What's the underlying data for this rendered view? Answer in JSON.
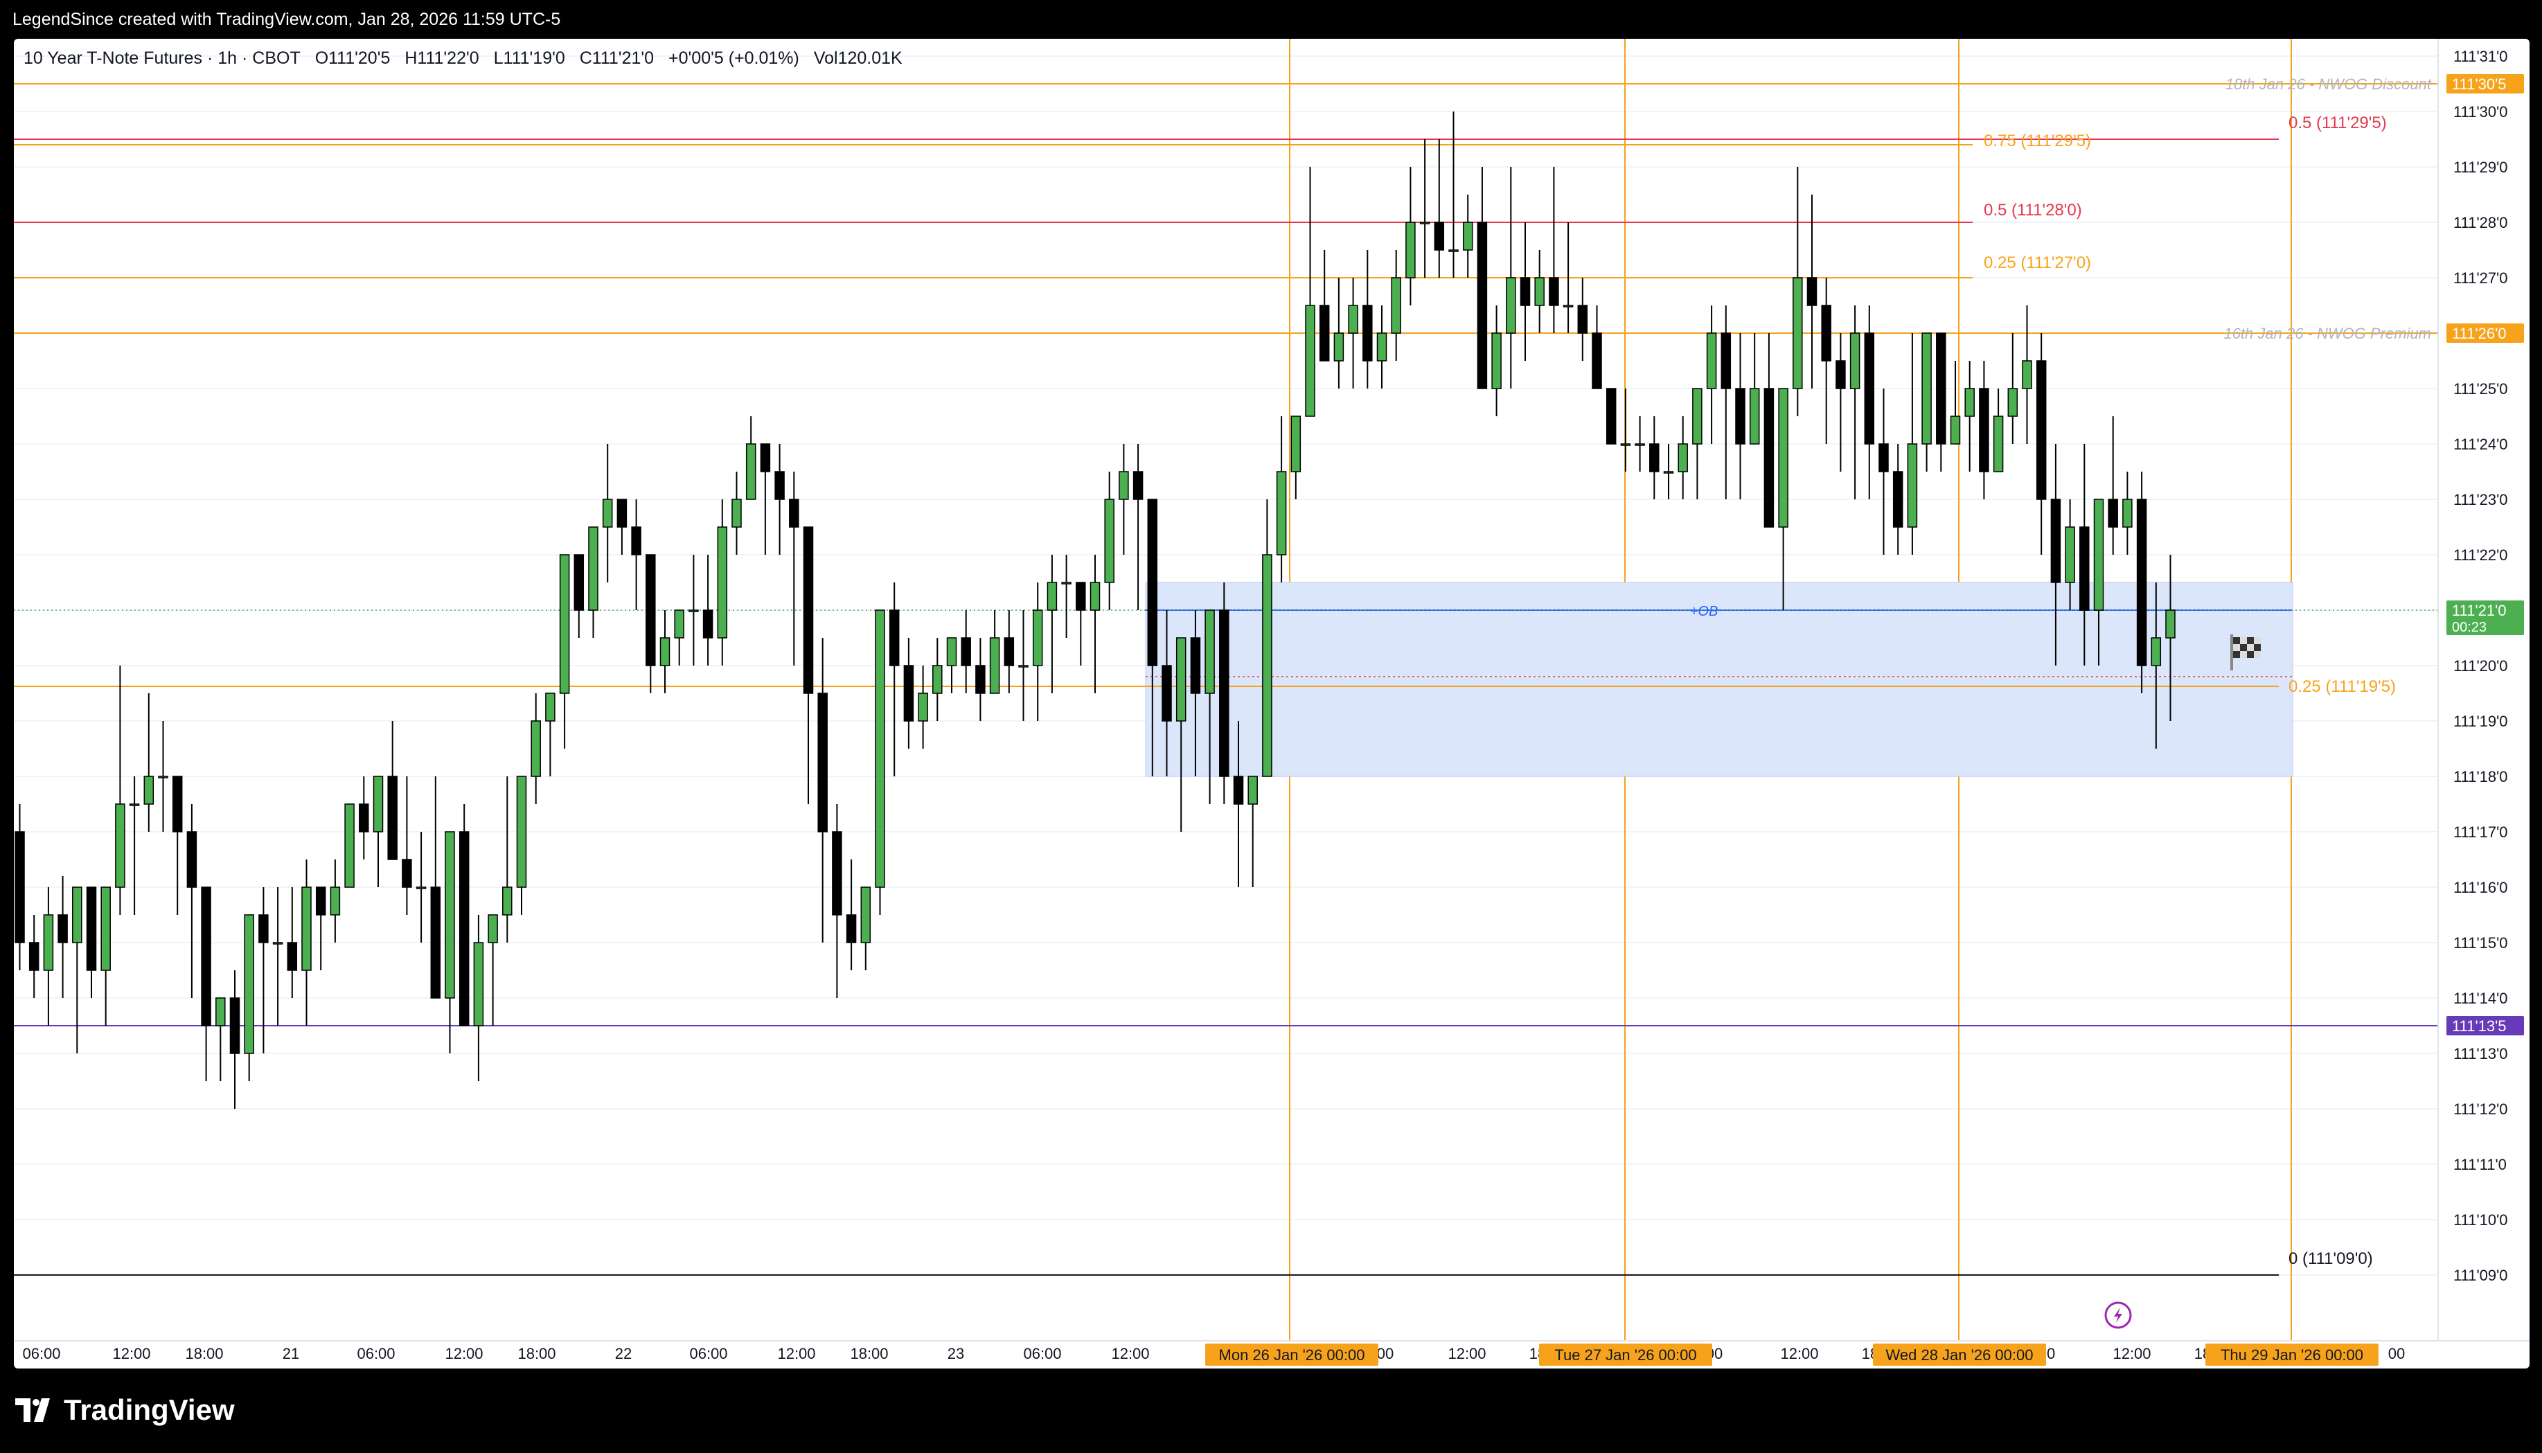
{
  "header": {
    "attribution": "LegendSince created with TradingView.com, Jan 28, 2026 11:59 UTC-5"
  },
  "legend": {
    "symbol": "10 Year T-Note Futures · 1h · CBOT",
    "open": "O111'20'5",
    "high": "H111'22'0",
    "low": "L111'19'0",
    "close": "C111'21'0",
    "change": "+0'00'5 (+0.01%)",
    "volume": "Vol120.01K"
  },
  "colors": {
    "up": "#4caf50",
    "down": "#000000",
    "level": "#f7a21b",
    "fib_red": "#e5384e",
    "purple": "#673ab7",
    "ob_fill": "#dce6fb",
    "ob_line": "#2962ff",
    "grid": "#f0f3fa"
  },
  "price_axis": {
    "ticks": [
      "111'31'0",
      "111'30'0",
      "111'29'0",
      "111'28'0",
      "111'27'0",
      "111'26'0",
      "111'25'0",
      "111'24'0",
      "111'23'0",
      "111'22'0",
      "111'21'0",
      "111'20'0",
      "111'19'0",
      "111'18'0",
      "111'17'0",
      "111'16'0",
      "111'15'0",
      "111'14'0",
      "111'13'0",
      "111'12'0",
      "111'11'0",
      "111'10'0",
      "111'09'0"
    ],
    "tags": [
      {
        "label": "111'30'5",
        "price": 30.5,
        "color": "#f7a21b"
      },
      {
        "label": "111'26'0",
        "price": 26.0,
        "color": "#f7a21b"
      },
      {
        "label": "111'21'0",
        "sub": "00:23",
        "price": 21.0,
        "color": "#4caf50"
      },
      {
        "label": "111'13'5",
        "price": 13.5,
        "color": "#673ab7"
      }
    ]
  },
  "time_axis": {
    "ticks": [
      "06:00",
      "12:00",
      "18:00",
      "21",
      "06:00",
      "12:00",
      "18:00",
      "22",
      "06:00",
      "12:00",
      "18:00",
      "23",
      "06:00",
      "12:00",
      "00",
      "12:00",
      "18",
      "00",
      "12:00",
      "18",
      "00",
      "12:00",
      "18",
      "00"
    ],
    "highlights": [
      "Mon 26 Jan '26   00:00",
      "Tue 27 Jan '26   00:00",
      "Wed 28 Jan '26   00:00",
      "Thu 29 Jan '26   00:00"
    ]
  },
  "annotations": {
    "nwog_discount": "18th Jan 26 - NWOG Discount",
    "nwog_premium": "16th Jan 26 - NWOG Premium",
    "fib_075": "0.75 (111'29'5)",
    "fib_05_a": "0.5 (111'28'0)",
    "fib_025_a": "0.25 (111'27'0)",
    "fib_05_b": "0.5 (111'29'5)",
    "fib_025_b": "0.25 (111'19'5)",
    "fib_0": "0 (111'09'0)",
    "ob": "+OB"
  },
  "footer": {
    "brand": "TradingView"
  },
  "chart_data": {
    "type": "candlestick",
    "symbol": "10 Year T-Note Futures",
    "timeframe": "1h",
    "price_unit": "32nds above 111",
    "ylim": [
      8.5,
      31.5
    ],
    "candles": [
      [
        17.0,
        17.5,
        14.5,
        15.0
      ],
      [
        15.0,
        15.5,
        14.0,
        14.5
      ],
      [
        14.5,
        16.0,
        13.5,
        15.5
      ],
      [
        15.5,
        16.2,
        14.0,
        15.0
      ],
      [
        15.0,
        16.0,
        13.0,
        16.0
      ],
      [
        16.0,
        16.0,
        14.0,
        14.5
      ],
      [
        14.5,
        16.0,
        13.5,
        16.0
      ],
      [
        16.0,
        20.0,
        15.5,
        17.5
      ],
      [
        17.5,
        18.0,
        15.5,
        17.5
      ],
      [
        17.5,
        19.5,
        17.0,
        18.0
      ],
      [
        18.0,
        19.0,
        17.0,
        18.0
      ],
      [
        18.0,
        18.0,
        15.5,
        17.0
      ],
      [
        17.0,
        17.5,
        14.0,
        16.0
      ],
      [
        16.0,
        16.0,
        12.5,
        13.5
      ],
      [
        13.5,
        14.0,
        12.5,
        14.0
      ],
      [
        14.0,
        14.5,
        12.0,
        13.0
      ],
      [
        13.0,
        15.0,
        12.5,
        15.5
      ],
      [
        15.5,
        16.0,
        13.0,
        15.0
      ],
      [
        15.0,
        16.0,
        13.5,
        15.0
      ],
      [
        15.0,
        16.0,
        14.0,
        14.5
      ],
      [
        14.5,
        16.5,
        13.5,
        16.0
      ],
      [
        16.0,
        16.0,
        14.5,
        15.5
      ],
      [
        15.5,
        16.5,
        15.0,
        16.0
      ],
      [
        16.0,
        17.5,
        16.0,
        17.5
      ],
      [
        17.5,
        18.0,
        16.5,
        17.0
      ],
      [
        17.0,
        18.0,
        16.0,
        18.0
      ],
      [
        18.0,
        19.0,
        16.5,
        16.5
      ],
      [
        16.5,
        18.0,
        15.5,
        16.0
      ],
      [
        16.0,
        17.0,
        15.0,
        16.0
      ],
      [
        16.0,
        18.0,
        14.0,
        14.0
      ],
      [
        14.0,
        17.0,
        13.0,
        17.0
      ],
      [
        17.0,
        17.5,
        13.5,
        13.5
      ],
      [
        13.5,
        15.5,
        12.5,
        15.0
      ],
      [
        15.0,
        15.5,
        13.5,
        15.5
      ],
      [
        15.5,
        18.0,
        15.0,
        16.0
      ],
      [
        16.0,
        18.0,
        15.5,
        18.0
      ],
      [
        18.0,
        19.5,
        17.5,
        19.0
      ],
      [
        19.0,
        19.5,
        18.0,
        19.5
      ],
      [
        19.5,
        22.0,
        18.5,
        22.0
      ],
      [
        22.0,
        22.0,
        20.5,
        21.0
      ],
      [
        21.0,
        22.5,
        20.5,
        22.5
      ],
      [
        22.5,
        24.0,
        21.5,
        23.0
      ],
      [
        23.0,
        23.0,
        22.0,
        22.5
      ],
      [
        22.5,
        23.0,
        21.0,
        22.0
      ],
      [
        22.0,
        22.0,
        19.5,
        20.0
      ],
      [
        20.0,
        21.0,
        19.5,
        20.5
      ],
      [
        20.5,
        21.0,
        20.0,
        21.0
      ],
      [
        21.0,
        22.0,
        20.0,
        21.0
      ],
      [
        21.0,
        22.0,
        20.0,
        20.5
      ],
      [
        20.5,
        23.0,
        20.0,
        22.5
      ],
      [
        22.5,
        23.5,
        22.0,
        23.0
      ],
      [
        23.0,
        24.5,
        23.0,
        24.0
      ],
      [
        24.0,
        24.0,
        22.0,
        23.5
      ],
      [
        23.5,
        24.0,
        22.0,
        23.0
      ],
      [
        23.0,
        23.5,
        20.0,
        22.5
      ],
      [
        22.5,
        22.0,
        17.5,
        19.5
      ],
      [
        19.5,
        20.5,
        15.0,
        17.0
      ],
      [
        17.0,
        17.5,
        14.0,
        15.5
      ],
      [
        15.5,
        16.5,
        14.5,
        15.0
      ],
      [
        15.0,
        16.0,
        14.5,
        16.0
      ],
      [
        16.0,
        21.0,
        15.5,
        21.0
      ],
      [
        21.0,
        21.5,
        18.0,
        20.0
      ],
      [
        20.0,
        20.5,
        18.5,
        19.0
      ],
      [
        19.0,
        20.0,
        18.5,
        19.5
      ],
      [
        19.5,
        20.5,
        19.0,
        20.0
      ],
      [
        20.0,
        20.5,
        19.5,
        20.5
      ],
      [
        20.5,
        21.0,
        19.5,
        20.0
      ],
      [
        20.0,
        20.5,
        19.0,
        19.5
      ],
      [
        19.5,
        21.0,
        19.5,
        20.5
      ],
      [
        20.5,
        21.0,
        19.5,
        20.0
      ],
      [
        20.0,
        21.0,
        19.0,
        20.0
      ],
      [
        20.0,
        21.5,
        19.0,
        21.0
      ],
      [
        21.0,
        22.0,
        19.5,
        21.5
      ],
      [
        21.5,
        22.0,
        20.5,
        21.5
      ],
      [
        21.5,
        21.5,
        20.0,
        21.0
      ],
      [
        21.0,
        22.0,
        19.5,
        21.5
      ],
      [
        21.5,
        23.5,
        21.0,
        23.0
      ],
      [
        23.0,
        24.0,
        22.0,
        23.5
      ],
      [
        23.5,
        24.0,
        21.0,
        23.0
      ],
      [
        23.0,
        23.0,
        18.0,
        20.0
      ],
      [
        20.0,
        21.0,
        18.0,
        19.0
      ],
      [
        19.0,
        20.5,
        17.0,
        20.5
      ],
      [
        20.5,
        21.0,
        18.0,
        19.5
      ],
      [
        19.5,
        21.0,
        17.5,
        21.0
      ],
      [
        21.0,
        21.5,
        17.5,
        18.0
      ],
      [
        18.0,
        19.0,
        16.0,
        17.5
      ],
      [
        17.5,
        18.0,
        16.0,
        18.0
      ],
      [
        18.0,
        23.0,
        18.0,
        22.0
      ],
      [
        22.0,
        24.5,
        21.5,
        23.5
      ],
      [
        23.5,
        24.5,
        23.0,
        24.5
      ],
      [
        24.5,
        29.0,
        25.0,
        26.5
      ],
      [
        26.5,
        27.5,
        25.5,
        25.5
      ],
      [
        25.5,
        27.0,
        25.0,
        26.0
      ],
      [
        26.0,
        27.0,
        25.0,
        26.5
      ],
      [
        26.5,
        27.5,
        25.0,
        25.5
      ],
      [
        25.5,
        26.5,
        25.0,
        26.0
      ],
      [
        26.0,
        27.5,
        25.5,
        27.0
      ],
      [
        27.0,
        29.0,
        26.5,
        28.0
      ],
      [
        28.0,
        29.5,
        27.0,
        28.0
      ],
      [
        28.0,
        29.5,
        27.0,
        27.5
      ],
      [
        27.5,
        30.0,
        27.0,
        27.5
      ],
      [
        27.5,
        28.5,
        27.0,
        28.0
      ],
      [
        28.0,
        29.0,
        25.0,
        25.0
      ],
      [
        25.0,
        26.5,
        24.5,
        26.0
      ],
      [
        26.0,
        29.0,
        25.0,
        27.0
      ],
      [
        27.0,
        28.0,
        25.5,
        26.5
      ],
      [
        26.5,
        27.5,
        26.0,
        27.0
      ],
      [
        27.0,
        29.0,
        26.0,
        26.5
      ],
      [
        26.5,
        28.0,
        26.0,
        26.5
      ],
      [
        26.5,
        27.0,
        25.5,
        26.0
      ],
      [
        26.0,
        26.5,
        25.0,
        25.0
      ],
      [
        25.0,
        25.0,
        24.0,
        24.0
      ],
      [
        24.0,
        25.0,
        23.5,
        24.0
      ],
      [
        24.0,
        24.5,
        23.5,
        24.0
      ],
      [
        24.0,
        24.5,
        23.0,
        23.5
      ],
      [
        23.5,
        24.0,
        23.0,
        23.5
      ],
      [
        23.5,
        24.5,
        23.0,
        24.0
      ],
      [
        24.0,
        25.0,
        23.0,
        25.0
      ],
      [
        25.0,
        26.5,
        24.0,
        26.0
      ],
      [
        26.0,
        26.5,
        23.0,
        25.0
      ],
      [
        25.0,
        26.0,
        23.0,
        24.0
      ],
      [
        24.0,
        26.0,
        24.0,
        25.0
      ],
      [
        25.0,
        26.0,
        22.5,
        22.5
      ],
      [
        22.5,
        24.5,
        21.0,
        25.0
      ],
      [
        25.0,
        29.0,
        24.5,
        27.0
      ],
      [
        27.0,
        28.5,
        25.0,
        26.5
      ],
      [
        26.5,
        27.0,
        24.0,
        25.5
      ],
      [
        25.5,
        26.0,
        23.5,
        25.0
      ],
      [
        25.0,
        26.5,
        23.0,
        26.0
      ],
      [
        26.0,
        26.5,
        23.0,
        24.0
      ],
      [
        24.0,
        25.0,
        22.0,
        23.5
      ],
      [
        23.5,
        24.0,
        22.0,
        22.5
      ],
      [
        22.5,
        26.0,
        22.0,
        24.0
      ],
      [
        24.0,
        26.0,
        23.5,
        26.0
      ],
      [
        26.0,
        26.0,
        23.5,
        24.0
      ],
      [
        24.0,
        25.5,
        24.0,
        24.5
      ],
      [
        24.5,
        25.5,
        23.5,
        25.0
      ],
      [
        25.0,
        25.5,
        23.0,
        23.5
      ],
      [
        23.5,
        25.0,
        23.5,
        24.5
      ],
      [
        24.5,
        26.0,
        24.0,
        25.0
      ],
      [
        25.0,
        26.5,
        24.0,
        25.5
      ],
      [
        25.5,
        26.0,
        22.0,
        23.0
      ],
      [
        23.0,
        24.0,
        20.0,
        21.5
      ],
      [
        21.5,
        23.0,
        21.0,
        22.5
      ],
      [
        22.5,
        24.0,
        20.0,
        21.0
      ],
      [
        21.0,
        23.0,
        20.0,
        23.0
      ],
      [
        23.0,
        24.5,
        22.0,
        22.5
      ],
      [
        22.5,
        23.5,
        22.0,
        23.0
      ],
      [
        23.0,
        23.5,
        19.5,
        20.0
      ],
      [
        20.0,
        21.5,
        18.5,
        20.5
      ],
      [
        20.5,
        22.0,
        19.0,
        21.0
      ]
    ],
    "levels": [
      {
        "label": "18th Jan 26 - NWOG Discount",
        "price": 30.5
      },
      {
        "label": "16th Jan 26 - NWOG Premium",
        "price": 26.0
      },
      {
        "label": "0.75 (111'29'5)",
        "price": 29.5
      },
      {
        "label": "0.5 (111'28'0)",
        "price": 28.0
      },
      {
        "label": "0.25 (111'27'0)",
        "price": 27.0
      },
      {
        "label": "0.5 (111'29'5)",
        "price": 29.5
      },
      {
        "label": "0.25 (111'19'5)",
        "price": 19.5
      },
      {
        "label": "0 (111'09'0)",
        "price": 9.0
      },
      {
        "label": "111'13'5",
        "price": 13.5
      }
    ],
    "zones": [
      {
        "label": "+OB",
        "top": 21.5,
        "bottom": 18.0
      }
    ]
  }
}
